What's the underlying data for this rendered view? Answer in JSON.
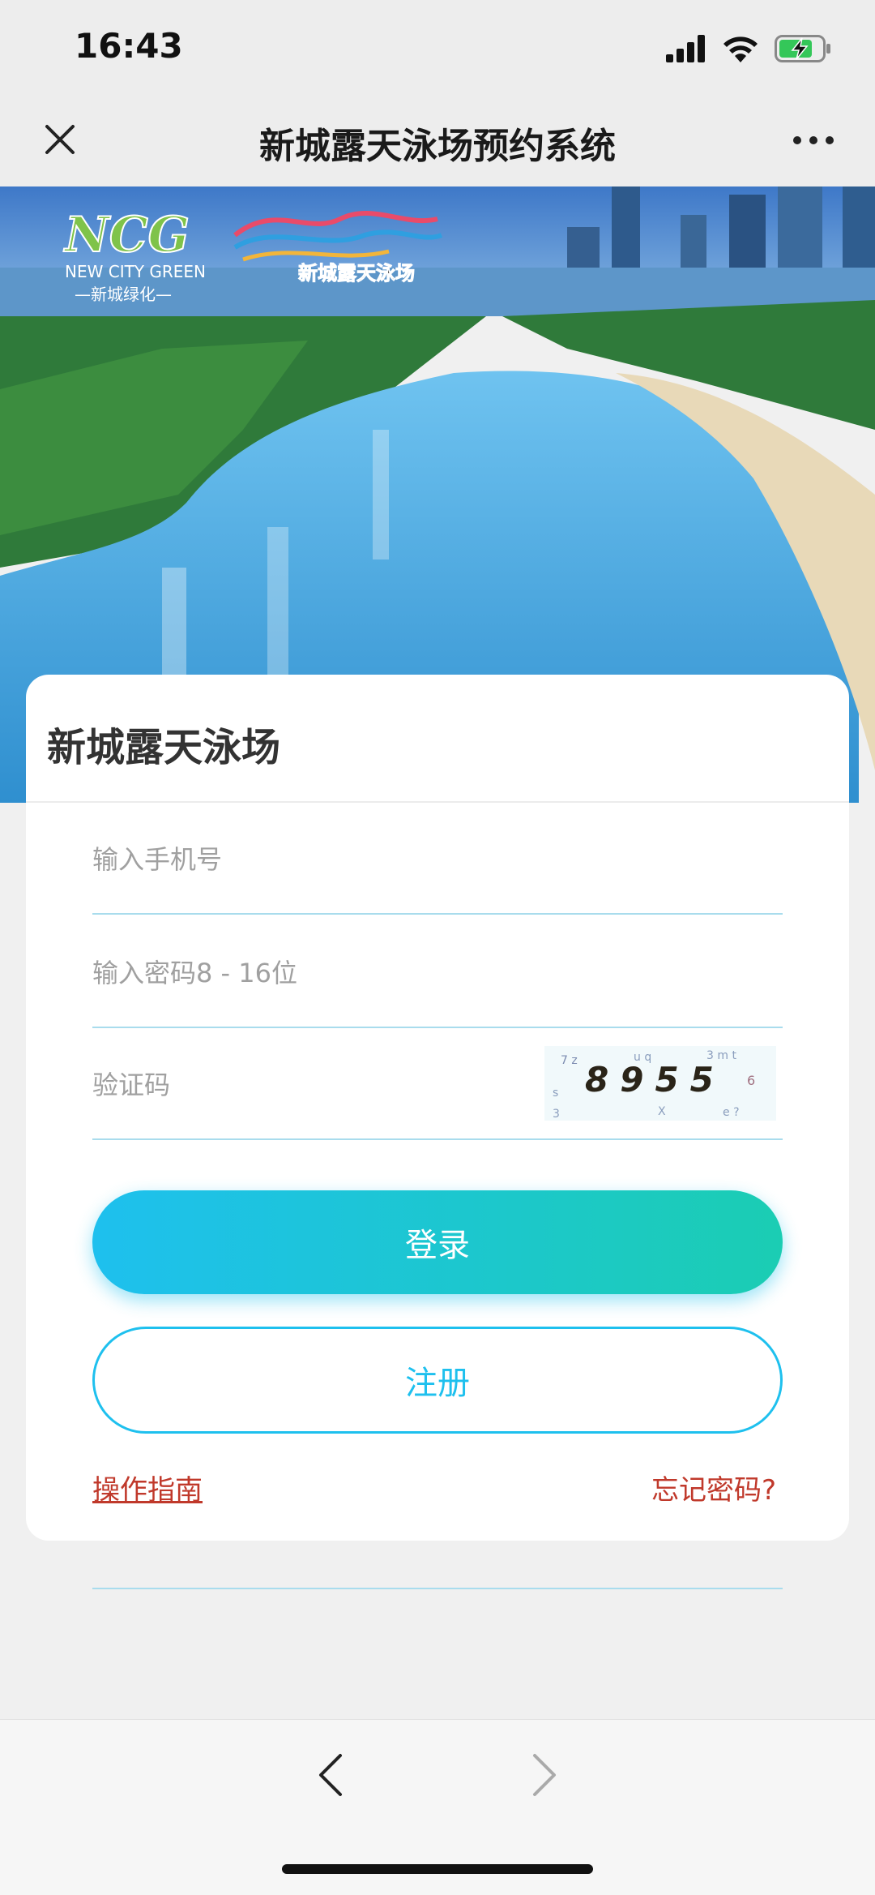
{
  "status_bar": {
    "time": "16:43"
  },
  "nav": {
    "title": "新城露天泳场预约系统"
  },
  "banner": {
    "logo_left": "NCG",
    "logo_left_sub": "NEW CITY GREEN",
    "logo_left_cn": "—新城绿化—",
    "logo_right_cn": "新城露天泳场"
  },
  "card": {
    "title": "新城露天泳场",
    "phone_placeholder": "输入手机号",
    "password_placeholder": "输入密码8 - 16位",
    "captcha_placeholder": "验证码",
    "captcha_code": "8955",
    "login_label": "登录",
    "register_label": "注册",
    "guide_link": "操作指南",
    "forgot_link": "忘记密码?"
  },
  "colors": {
    "accent": "#1ec0ee",
    "accent_end": "#1bcdb3",
    "link_red": "#c0392b"
  }
}
